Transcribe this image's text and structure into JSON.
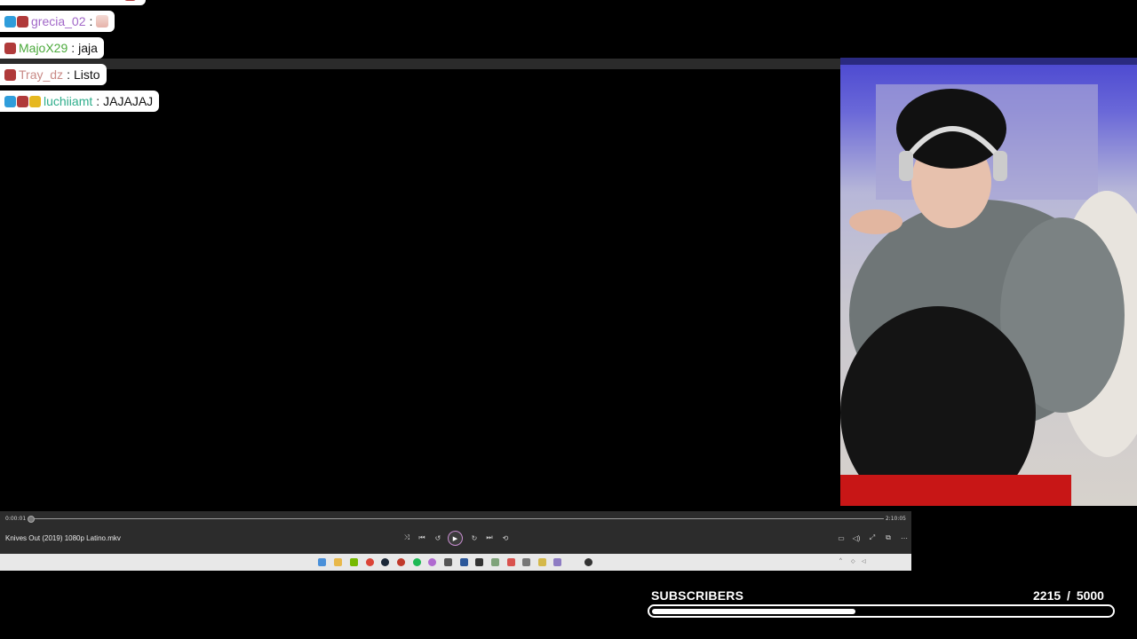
{
  "chat": {
    "messages": [
      {
        "badges": [
          "bear-badge"
        ],
        "username": "",
        "text": "",
        "name_color": "#9b6fb8",
        "partial": true
      },
      {
        "badges": [
          "prime-badge",
          "bear-badge"
        ],
        "username": "grecia_02",
        "text": "",
        "name_color": "#a268c8",
        "emote": "hand-emote"
      },
      {
        "badges": [
          "bear-badge"
        ],
        "username": "MajoX29",
        "text": "jaja",
        "name_color": "#4caa3c"
      },
      {
        "badges": [
          "bear-badge"
        ],
        "username": "Tray_dz",
        "text": "Listo",
        "name_color": "#c98a86"
      },
      {
        "badges": [
          "prime-badge",
          "bear-badge",
          "crown-badge"
        ],
        "username": "luchiiamt",
        "text": "JAJAJAJ",
        "name_color": "#2fae8c"
      }
    ],
    "separator": ":"
  },
  "player": {
    "file_name": "Knives Out (2019) 1080p Latino.mkv",
    "current_time": "0:00:01",
    "duration": "2:10:05",
    "progress": 0.0,
    "controls": [
      "shuffle-icon",
      "previous-icon",
      "rewind-icon",
      "play-icon",
      "forward-icon",
      "next-icon",
      "repeat-icon"
    ],
    "right_controls": [
      "subtitles-icon",
      "volume-icon",
      "fullscreen-icon",
      "miniplayer-icon",
      "more-icon"
    ],
    "accent_color": "#c88dd0"
  },
  "taskbar": {
    "app_icons": [
      "start-icon",
      "file-explorer-icon",
      "nvidia-icon",
      "chrome-icon",
      "steam-icon",
      "app-icon",
      "spotify-icon",
      "app-icon",
      "calculator-icon",
      "word-icon",
      "app-icon",
      "app-icon",
      "app-icon",
      "app-icon",
      "app-icon",
      "media-player-icon"
    ],
    "tray_icons": [
      "chevron-up-icon",
      "network-icon",
      "volume-icon"
    ]
  },
  "subgoal": {
    "label": "SUBSCRIBERS",
    "current": "2215",
    "target": "/ 5000",
    "fraction": 0.443
  }
}
